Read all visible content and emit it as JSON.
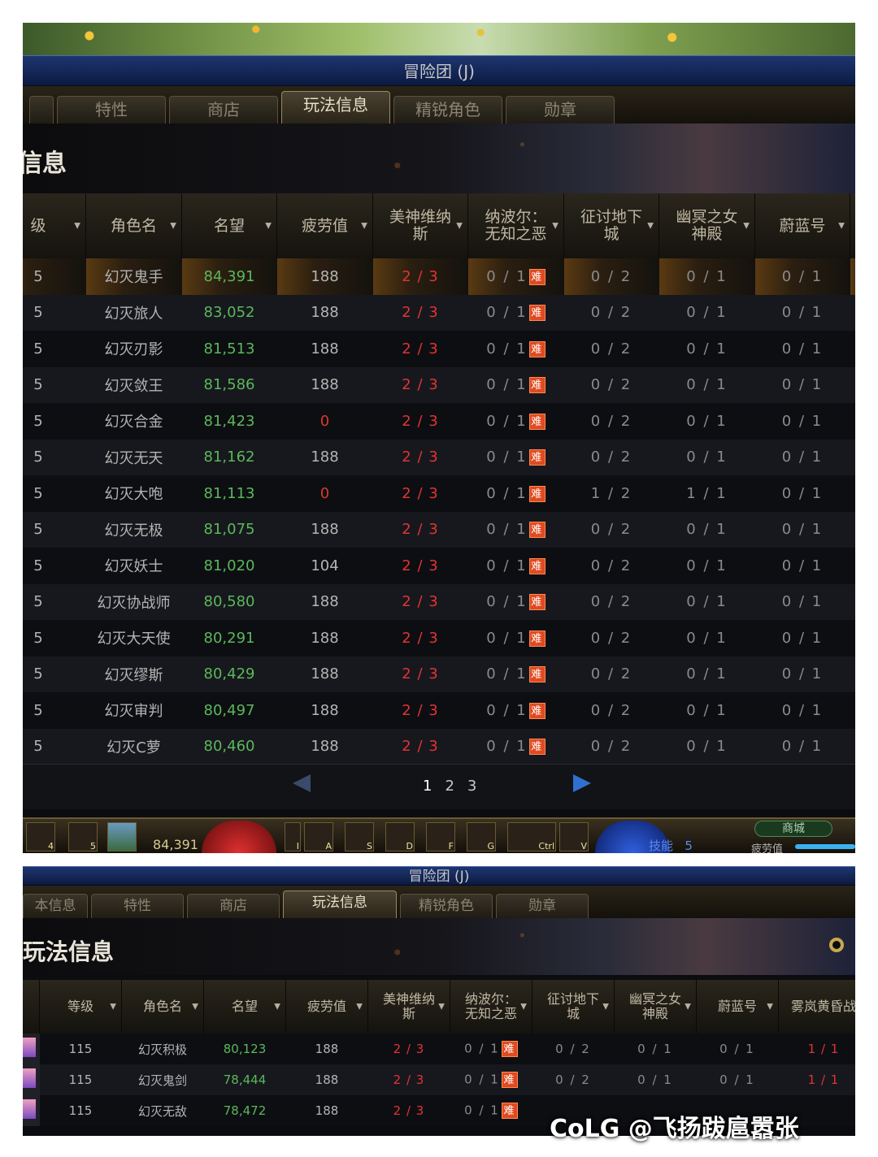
{
  "screenshots": [
    {
      "window_title": "冒险团 (J)",
      "tabs": [
        {
          "label": ""
        },
        {
          "label": "特性"
        },
        {
          "label": "商店"
        },
        {
          "label": "玩法信息",
          "active": true
        },
        {
          "label": "精锐角色"
        },
        {
          "label": "勋章"
        }
      ],
      "section_title": "信息",
      "columns": [
        "级",
        "角色名",
        "名望",
        "疲劳值",
        "美神维纳斯",
        "纳波尔：无知之恶",
        "征讨地下城",
        "幽冥之女神殿",
        "蔚蓝号"
      ],
      "rows": [
        {
          "level": "5",
          "name": "幻灭鬼手",
          "fame": "84,391",
          "fatigue": "188",
          "venus": "2 / 3",
          "napol": "0 / 1",
          "dungeon": "0 / 2",
          "goddess": "0 / 1",
          "azure": "0 / 1"
        },
        {
          "level": "5",
          "name": "幻灭旅人",
          "fame": "83,052",
          "fatigue": "188",
          "venus": "2 / 3",
          "napol": "0 / 1",
          "dungeon": "0 / 2",
          "goddess": "0 / 1",
          "azure": "0 / 1"
        },
        {
          "level": "5",
          "name": "幻灭刃影",
          "fame": "81,513",
          "fatigue": "188",
          "venus": "2 / 3",
          "napol": "0 / 1",
          "dungeon": "0 / 2",
          "goddess": "0 / 1",
          "azure": "0 / 1"
        },
        {
          "level": "5",
          "name": "幻灭敛王",
          "fame": "81,586",
          "fatigue": "188",
          "venus": "2 / 3",
          "napol": "0 / 1",
          "dungeon": "0 / 2",
          "goddess": "0 / 1",
          "azure": "0 / 1"
        },
        {
          "level": "5",
          "name": "幻灭合金",
          "fame": "81,423",
          "fatigue": "0",
          "venus": "2 / 3",
          "napol": "0 / 1",
          "dungeon": "0 / 2",
          "goddess": "0 / 1",
          "azure": "0 / 1"
        },
        {
          "level": "5",
          "name": "幻灭无天",
          "fame": "81,162",
          "fatigue": "188",
          "venus": "2 / 3",
          "napol": "0 / 1",
          "dungeon": "0 / 2",
          "goddess": "0 / 1",
          "azure": "0 / 1"
        },
        {
          "level": "5",
          "name": "幻灭大咆",
          "fame": "81,113",
          "fatigue": "0",
          "venus": "2 / 3",
          "napol": "0 / 1",
          "dungeon": "1 / 2",
          "goddess": "1 / 1",
          "azure": "0 / 1"
        },
        {
          "level": "5",
          "name": "幻灭无极",
          "fame": "81,075",
          "fatigue": "188",
          "venus": "2 / 3",
          "napol": "0 / 1",
          "dungeon": "0 / 2",
          "goddess": "0 / 1",
          "azure": "0 / 1"
        },
        {
          "level": "5",
          "name": "幻灭妖士",
          "fame": "81,020",
          "fatigue": "104",
          "venus": "2 / 3",
          "napol": "0 / 1",
          "dungeon": "0 / 2",
          "goddess": "0 / 1",
          "azure": "0 / 1"
        },
        {
          "level": "5",
          "name": "幻灭协战师",
          "fame": "80,580",
          "fatigue": "188",
          "venus": "2 / 3",
          "napol": "0 / 1",
          "dungeon": "0 / 2",
          "goddess": "0 / 1",
          "azure": "0 / 1"
        },
        {
          "level": "5",
          "name": "幻灭大天使",
          "fame": "80,291",
          "fatigue": "188",
          "venus": "2 / 3",
          "napol": "0 / 1",
          "dungeon": "0 / 2",
          "goddess": "0 / 1",
          "azure": "0 / 1"
        },
        {
          "level": "5",
          "name": "幻灭缪斯",
          "fame": "80,429",
          "fatigue": "188",
          "venus": "2 / 3",
          "napol": "0 / 1",
          "dungeon": "0 / 2",
          "goddess": "0 / 1",
          "azure": "0 / 1"
        },
        {
          "level": "5",
          "name": "幻灭审判",
          "fame": "80,497",
          "fatigue": "188",
          "venus": "2 / 3",
          "napol": "0 / 1",
          "dungeon": "0 / 2",
          "goddess": "0 / 1",
          "azure": "0 / 1"
        },
        {
          "level": "5",
          "name": "幻灭C萝",
          "fame": "80,460",
          "fatigue": "188",
          "venus": "2 / 3",
          "napol": "0 / 1",
          "dungeon": "0 / 2",
          "goddess": "0 / 1",
          "azure": "0 / 1"
        }
      ],
      "hard_badge": "难",
      "pages": [
        "1",
        "2",
        "3"
      ],
      "hud": {
        "slot_keys": [
          "4",
          "5"
        ],
        "hotkeys": [
          "I",
          "A",
          "S",
          "D",
          "F",
          "G",
          "Ctrl",
          "V"
        ],
        "fame": "84,391",
        "skill_label": "技能",
        "skill_points": "5",
        "shop_label": "商城",
        "fatigue_label": "疲劳值"
      },
      "colors": {
        "accent_red": "#e03434",
        "fame_green": "#5ab85a",
        "hard_badge": "#e04a20",
        "title_blue": "#1e3570"
      }
    },
    {
      "window_title": "冒险团 (J)",
      "tabs": [
        {
          "label": "本信息"
        },
        {
          "label": "特性"
        },
        {
          "label": "商店"
        },
        {
          "label": "玩法信息",
          "active": true
        },
        {
          "label": "精锐角色"
        },
        {
          "label": "勋章"
        }
      ],
      "section_title": "玩法信息",
      "columns": [
        "",
        "等级",
        "角色名",
        "名望",
        "疲劳值",
        "美神维纳斯",
        "纳波尔：无知之恶",
        "征讨地下城",
        "幽冥之女神殿",
        "蔚蓝号",
        "雾岚黄昏战"
      ],
      "rows": [
        {
          "level": "115",
          "name": "幻灭积极",
          "fame": "80,123",
          "fatigue": "188",
          "venus": "2 / 3",
          "napol": "0 / 1",
          "dungeon": "0 / 2",
          "goddess": "0 / 1",
          "azure": "0 / 1",
          "dusk": "1 / 1"
        },
        {
          "level": "115",
          "name": "幻灭鬼剑",
          "fame": "78,444",
          "fatigue": "188",
          "venus": "2 / 3",
          "napol": "0 / 1",
          "dungeon": "0 / 2",
          "goddess": "0 / 1",
          "azure": "0 / 1",
          "dusk": "1 / 1"
        },
        {
          "level": "115",
          "name": "幻灭无敌",
          "fame": "78,472",
          "fatigue": "188",
          "venus": "2 / 3",
          "napol": "0 / 1",
          "dungeon": "",
          "goddess": "",
          "azure": "",
          "dusk": ""
        }
      ],
      "hard_badge": "难"
    }
  ],
  "watermark": "CoLG @飞扬跋扈嚣张"
}
